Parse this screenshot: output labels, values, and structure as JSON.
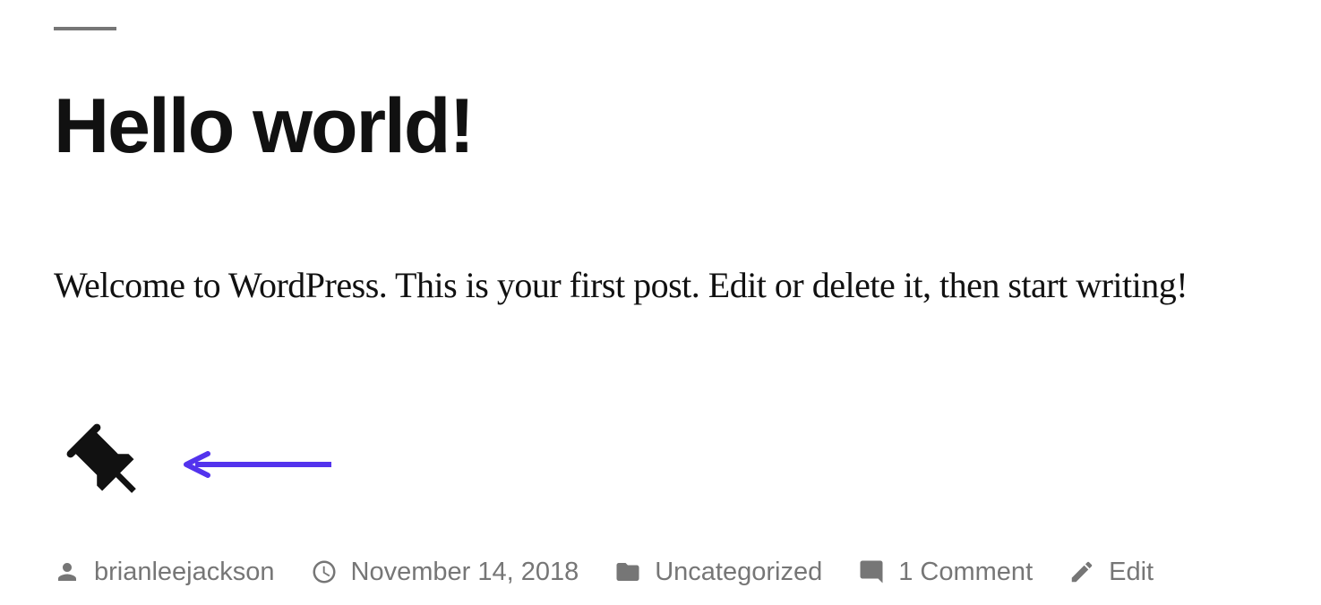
{
  "post": {
    "title": "Hello world!",
    "content": "Welcome to WordPress. This is your first post. Edit or delete it, then start writing!",
    "is_sticky": true
  },
  "meta": {
    "author": "brianleejackson",
    "date": "November 14, 2018",
    "category": "Uncategorized",
    "comments": "1 Comment",
    "edit": "Edit"
  },
  "annotation": {
    "arrow_color": "#5333ed"
  }
}
